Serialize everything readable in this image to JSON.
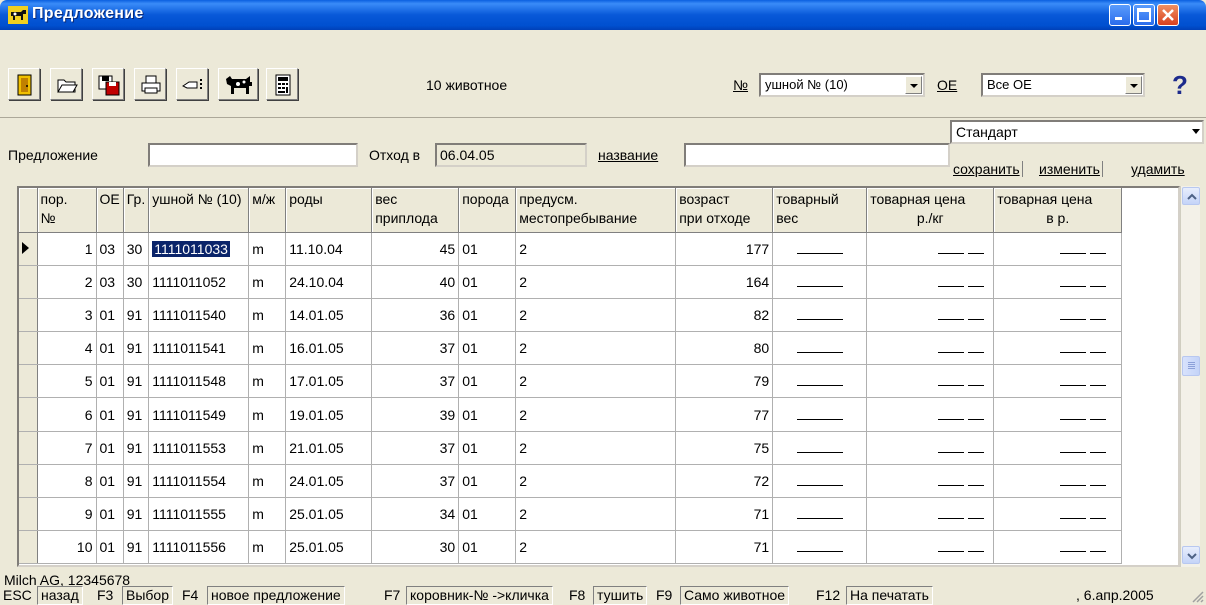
{
  "window": {
    "title": "Предложение",
    "accent": "#0858d8"
  },
  "toolbar": {
    "buttons": [
      {
        "icon": "exit-door-icon"
      },
      {
        "icon": "open-folder-icon"
      },
      {
        "icon": "save-disk-icon"
      },
      {
        "icon": "printer-icon"
      },
      {
        "icon": "select-pointer-icon"
      },
      {
        "icon": "cow-icon"
      },
      {
        "icon": "calculator-icon"
      }
    ],
    "animal_count": "10 животное",
    "ear_label": "№",
    "ear_combo_value": "ушной № (10)",
    "oe_label": "OE",
    "oe_combo_value": "Все ОЕ",
    "help": "?"
  },
  "form": {
    "offer_label": "Предложение",
    "offer_value": "",
    "departure_label": "Отход в",
    "departure_value": "06.04.05",
    "name_label": "название",
    "name_value": "",
    "preset_value": "Стандарт",
    "save_label": "сохранить",
    "edit_label": "изменить",
    "delete_label": "удамить"
  },
  "table": {
    "headers": {
      "no": [
        "пор.",
        "№"
      ],
      "oe": [
        "ОЕ"
      ],
      "gr": [
        "Гр."
      ],
      "ear": [
        "ушной № (10)"
      ],
      "sex": [
        "м/ж"
      ],
      "birth": [
        "роды"
      ],
      "weight": [
        "вес",
        "приплода"
      ],
      "breed": [
        "порода"
      ],
      "stay": [
        "предусм.",
        "местопребывание"
      ],
      "age": [
        "возраст",
        "при отходе"
      ],
      "tweight": [
        "товарный",
        "вес"
      ],
      "pkg": [
        "товарная цена",
        "р./кг"
      ],
      "price": [
        "товарная цена",
        "в р."
      ]
    },
    "rows": [
      {
        "no": "1",
        "oe": "03",
        "gr": "30",
        "ear": "1111011033",
        "sex": "m",
        "birth": "11.10.04",
        "weight": "45",
        "breed": "01",
        "stay": "2",
        "age": "177"
      },
      {
        "no": "2",
        "oe": "03",
        "gr": "30",
        "ear": "1111011052",
        "sex": "m",
        "birth": "24.10.04",
        "weight": "40",
        "breed": "01",
        "stay": "2",
        "age": "164"
      },
      {
        "no": "3",
        "oe": "01",
        "gr": "91",
        "ear": "1111011540",
        "sex": "m",
        "birth": "14.01.05",
        "weight": "36",
        "breed": "01",
        "stay": "2",
        "age": "82"
      },
      {
        "no": "4",
        "oe": "01",
        "gr": "91",
        "ear": "1111011541",
        "sex": "m",
        "birth": "16.01.05",
        "weight": "37",
        "breed": "01",
        "stay": "2",
        "age": "80"
      },
      {
        "no": "5",
        "oe": "01",
        "gr": "91",
        "ear": "1111011548",
        "sex": "m",
        "birth": "17.01.05",
        "weight": "37",
        "breed": "01",
        "stay": "2",
        "age": "79"
      },
      {
        "no": "6",
        "oe": "01",
        "gr": "91",
        "ear": "1111011549",
        "sex": "m",
        "birth": "19.01.05",
        "weight": "39",
        "breed": "01",
        "stay": "2",
        "age": "77"
      },
      {
        "no": "7",
        "oe": "01",
        "gr": "91",
        "ear": "1111011553",
        "sex": "m",
        "birth": "21.01.05",
        "weight": "37",
        "breed": "01",
        "stay": "2",
        "age": "75"
      },
      {
        "no": "8",
        "oe": "01",
        "gr": "91",
        "ear": "1111011554",
        "sex": "m",
        "birth": "24.01.05",
        "weight": "37",
        "breed": "01",
        "stay": "2",
        "age": "72"
      },
      {
        "no": "9",
        "oe": "01",
        "gr": "91",
        "ear": "1111011555",
        "sex": "m",
        "birth": "25.01.05",
        "weight": "34",
        "breed": "01",
        "stay": "2",
        "age": "71"
      },
      {
        "no": "10",
        "oe": "01",
        "gr": "91",
        "ear": "1111011556",
        "sex": "m",
        "birth": "25.01.05",
        "weight": "30",
        "breed": "01",
        "stay": "2",
        "age": "71"
      }
    ],
    "selected_row": 1
  },
  "footer_info": "Milch AG, 12345678",
  "statusbar": {
    "items": [
      {
        "key": "ESC",
        "label": "назад"
      },
      {
        "key": "F3",
        "label": "Выбор"
      },
      {
        "key": "F4",
        "label": "новое предложение"
      },
      {
        "key": "F7",
        "label": "коровник-№ ->кличка"
      },
      {
        "key": "F8",
        "label": "тушить"
      },
      {
        "key": "F9",
        "label": "Само животное"
      },
      {
        "key": "F12",
        "label": "На печатать"
      }
    ],
    "date": ", 6.апр.2005"
  }
}
